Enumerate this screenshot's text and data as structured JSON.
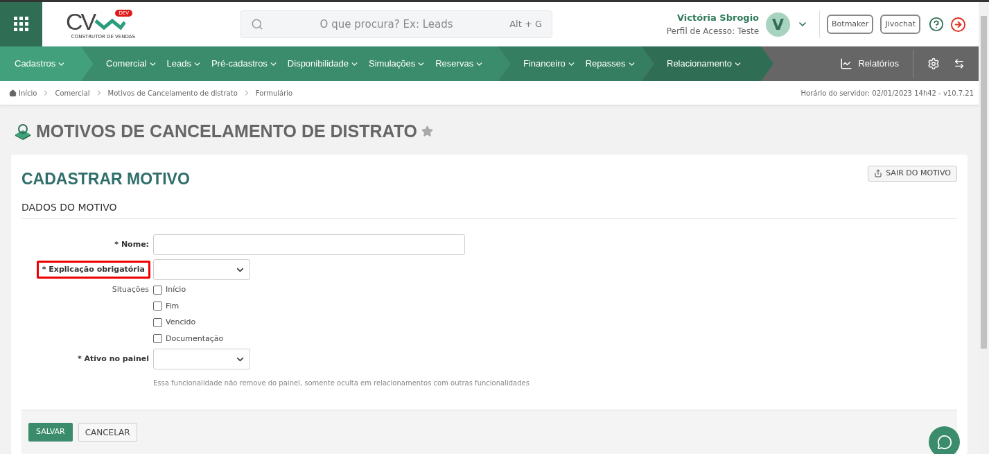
{
  "header": {
    "logo": {
      "letters": "CV",
      "badge": "DEV",
      "tagline": "CONSTRUTOR DE VENDAS"
    },
    "search": {
      "placeholder": "O que procura? Ex: Leads",
      "shortcut": "Alt + G"
    },
    "user": {
      "name": "Victória Sbrogio",
      "profile": "Perfil de Acesso: Teste",
      "initial": "V"
    },
    "buttons": [
      "Botmaker",
      "Jivochat"
    ]
  },
  "nav": {
    "groups": [
      {
        "items": [
          "Cadastros"
        ]
      },
      {
        "items": [
          "Comercial",
          "Leads",
          "Pré-cadastros",
          "Disponibilidade",
          "Simulações",
          "Reservas"
        ]
      },
      {
        "items": [
          "Financeiro",
          "Repasses"
        ]
      },
      {
        "items": [
          "Relacionamento"
        ]
      }
    ],
    "reports": "Relatórios"
  },
  "breadcrumb": [
    "Início",
    "Comercial",
    "Motivos de Cancelamento de distrato",
    "Formulário"
  ],
  "server_time": "Horário do servidor: 02/01/2023 14h42 - v10.7.21",
  "page_title": "MOTIVOS DE CANCELAMENTO DE DISTRATO",
  "favorite": false,
  "card": {
    "title": "CADASTRAR MOTIVO",
    "exit_button": "SAIR DO MOTIVO",
    "section": "DADOS DO MOTIVO",
    "fields": [
      {
        "kind": "text",
        "label": "* Nome:",
        "highlighted": false
      },
      {
        "kind": "select",
        "label": "* Explicação obrigatória",
        "highlighted": true
      },
      {
        "kind": "checks",
        "label": "Situações",
        "highlighted": false,
        "options": [
          {
            "label": "Início",
            "checked": false
          },
          {
            "label": "Fim",
            "checked": false
          },
          {
            "label": "Vencido",
            "checked": false
          },
          {
            "label": "Documentação",
            "checked": false
          }
        ]
      },
      {
        "kind": "select",
        "label": "* Ativo no painel",
        "highlighted": false,
        "hint": "Essa funcionalidade não remove do painel, somente oculta em relacionamentos com outras funcionalidades"
      }
    ],
    "save": "SALVAR",
    "cancel": "CANCELAR"
  }
}
